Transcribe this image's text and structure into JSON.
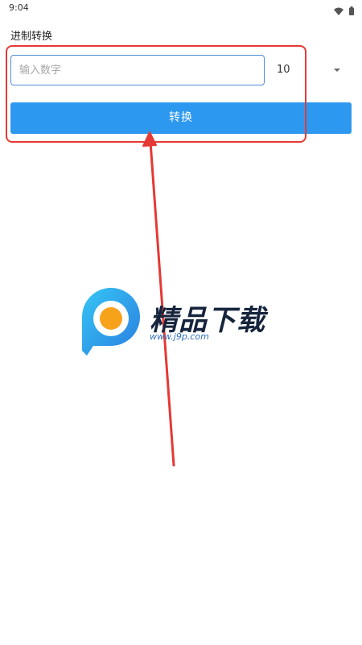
{
  "status_bar": {
    "time": "9:04",
    "icons": [
      "wifi-icon",
      "battery-icon"
    ]
  },
  "page": {
    "title": "进制转换"
  },
  "form": {
    "input_placeholder": "输入数字",
    "input_value": "",
    "base_selected": "10",
    "convert_label": "转换"
  },
  "watermark": {
    "brand": "精品下载",
    "url": "www.j9p.com"
  },
  "colors": {
    "accent": "#2d98f0",
    "annotation": "#e53935",
    "input_border": "#4a8fd6"
  }
}
